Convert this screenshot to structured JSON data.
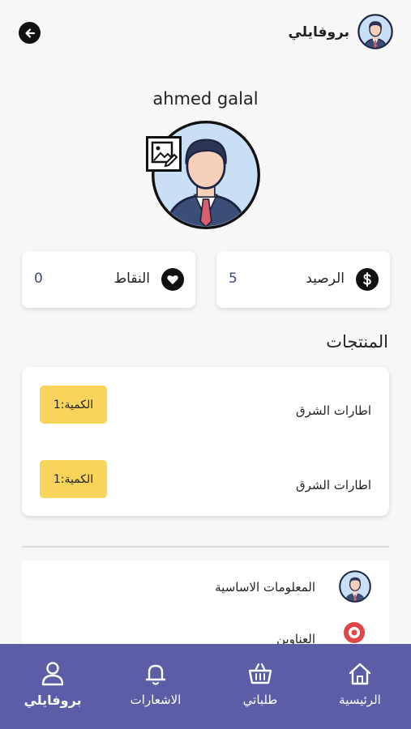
{
  "header": {
    "title": "بروفايلي",
    "back_icon": "arrow-left-icon",
    "avatar_icon": "user-avatar-icon"
  },
  "profile": {
    "name": "ahmed galal",
    "edit_photo_icon": "edit-image-icon"
  },
  "stats": {
    "balance": {
      "label": "الرصيد",
      "value": "5",
      "icon": "dollar-icon"
    },
    "points": {
      "label": "النقاط",
      "value": "0",
      "icon": "heart-icon"
    }
  },
  "products": {
    "title": "المنتجات",
    "items": [
      {
        "name": "اطارات الشرق",
        "quantity": "الكمية:1"
      },
      {
        "name": "اطارات الشرق",
        "quantity": "الكمية:1"
      }
    ]
  },
  "info": {
    "items": [
      {
        "label": "المعلومات الاساسية",
        "icon": "user-avatar-icon"
      },
      {
        "label": "العناوين",
        "icon": "location-pin-icon"
      }
    ]
  },
  "nav": {
    "items": [
      {
        "label": "الرئيسية",
        "icon": "home-icon",
        "active": false
      },
      {
        "label": "طلباتي",
        "icon": "basket-icon",
        "active": false
      },
      {
        "label": "الاشعارات",
        "icon": "bell-icon",
        "active": false
      },
      {
        "label": "بروفايلي",
        "icon": "user-icon",
        "active": true
      }
    ]
  },
  "colors": {
    "nav_bg": "#5b5ea6",
    "badge_yellow": "#f8d45b",
    "value_blue": "#3f4a7c"
  }
}
